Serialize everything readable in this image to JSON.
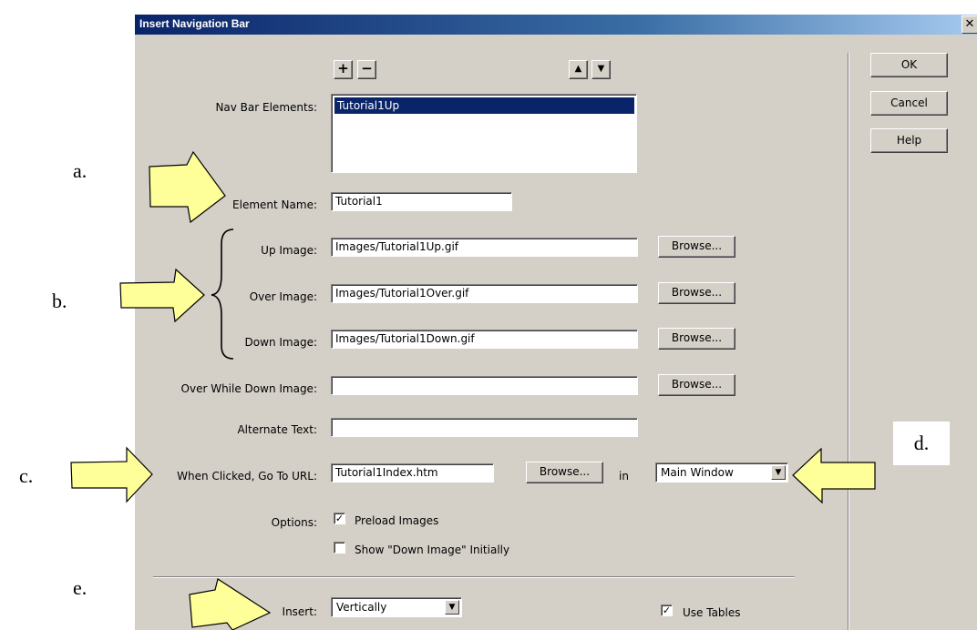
{
  "dialog": {
    "title": "Insert Navigation Bar",
    "close_glyph": "✕",
    "buttons": {
      "ok": "OK",
      "cancel": "Cancel",
      "help": "Help"
    }
  },
  "toolbar": {
    "add": "+",
    "remove": "−",
    "up": "▲",
    "down": "▼"
  },
  "nav_bar_elements": {
    "label": "Nav Bar Elements:",
    "items": [
      "Tutorial1Up"
    ]
  },
  "element_name": {
    "label": "Element Name:",
    "value": "Tutorial1"
  },
  "up_image": {
    "label": "Up Image:",
    "value": "Images/Tutorial1Up.gif"
  },
  "over_image": {
    "label": "Over Image:",
    "value": "Images/Tutorial1Over.gif"
  },
  "down_image": {
    "label": "Down Image:",
    "value": "Images/Tutorial1Down.gif"
  },
  "over_while_down": {
    "label": "Over While Down Image:",
    "value": ""
  },
  "alternate_text": {
    "label": "Alternate Text:",
    "value": ""
  },
  "browse_label": "Browse...",
  "url": {
    "label": "When Clicked, Go To URL:",
    "value": "Tutorial1Index.htm",
    "in_label": "in",
    "target": "Main Window"
  },
  "options": {
    "label": "Options:",
    "preload": {
      "label": "Preload Images",
      "checked": true
    },
    "show_down": {
      "label": "Show \"Down Image\" Initially",
      "checked": false
    }
  },
  "insert": {
    "label": "Insert:",
    "value": "Vertically"
  },
  "use_tables": {
    "label": "Use Tables",
    "checked": true
  },
  "annotations": {
    "a": "a.",
    "b": "b.",
    "c": "c.",
    "d": "d.",
    "e": "e."
  },
  "colors": {
    "arrow_fill": "#ffff99",
    "dialog_bg": "#d4d0c8",
    "titlebar": "#0a246a",
    "selection": "#0a246a"
  }
}
